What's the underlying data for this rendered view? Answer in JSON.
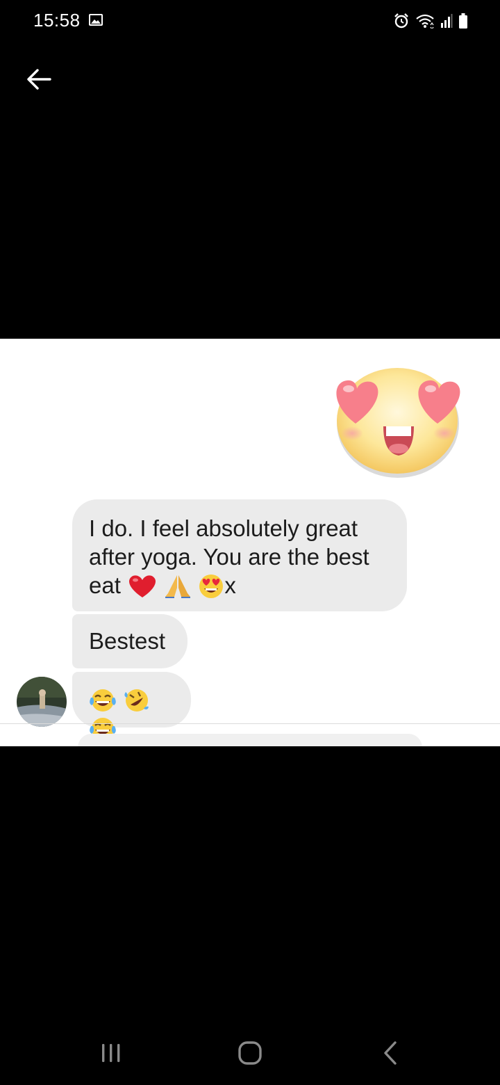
{
  "status_bar": {
    "time": "15:58",
    "icons": [
      "gallery-icon",
      "alarm-icon",
      "wifi-icon",
      "signal-icon",
      "battery-icon"
    ]
  },
  "header": {
    "back_icon": "arrow-left-icon"
  },
  "conversation": {
    "sticker": "heart-eyes-sticker",
    "messages": [
      {
        "lines": [
          "I do. I feel absolutely great",
          "after yoga. You are the best"
        ],
        "last_line_text": "eat",
        "trailing_emoji": [
          "red-heart-emoji",
          "folded-hands-emoji",
          "heart-eyes-emoji"
        ],
        "suffix": "x"
      },
      {
        "text": "Bestest"
      },
      {
        "emoji": [
          "tears-of-joy-emoji",
          "rolling-laughing-emoji",
          "tears-of-joy-emoji"
        ]
      }
    ],
    "avatar": "contact-avatar"
  },
  "navigation": {
    "icons": [
      "recents-icon",
      "home-icon",
      "back-icon"
    ]
  },
  "colors": {
    "background": "#000000",
    "panel": "#ffffff",
    "bubble": "#ebebeb",
    "text": "#1c1c1c"
  }
}
